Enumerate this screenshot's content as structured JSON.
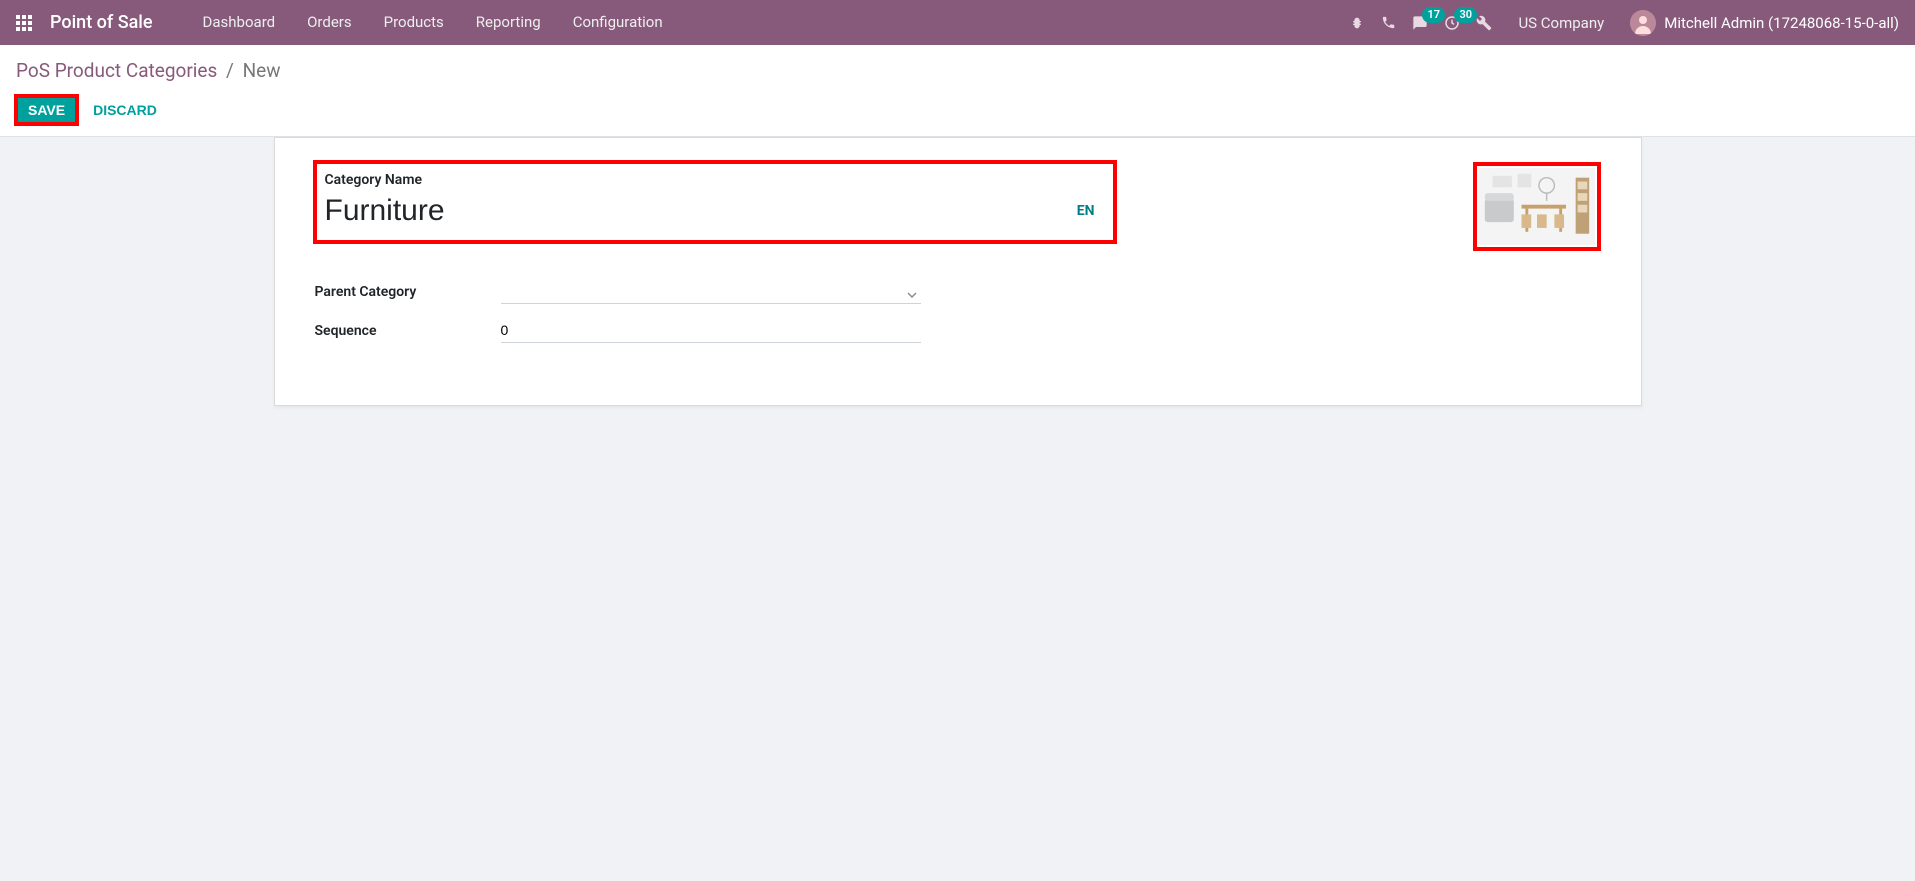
{
  "navbar": {
    "app_title": "Point of Sale",
    "links": [
      "Dashboard",
      "Orders",
      "Products",
      "Reporting",
      "Configuration"
    ],
    "msg_badge": "17",
    "activity_badge": "30",
    "company": "US Company",
    "user_name": "Mitchell Admin (17248068-15-0-all)"
  },
  "breadcrumb": {
    "parent": "PoS Product Categories",
    "current": "New"
  },
  "buttons": {
    "save": "Save",
    "discard": "Discard"
  },
  "form": {
    "category_label": "Category Name",
    "category_value": "Furniture",
    "lang": "EN",
    "parent_label": "Parent Category",
    "parent_value": "",
    "sequence_label": "Sequence",
    "sequence_value": "0"
  }
}
